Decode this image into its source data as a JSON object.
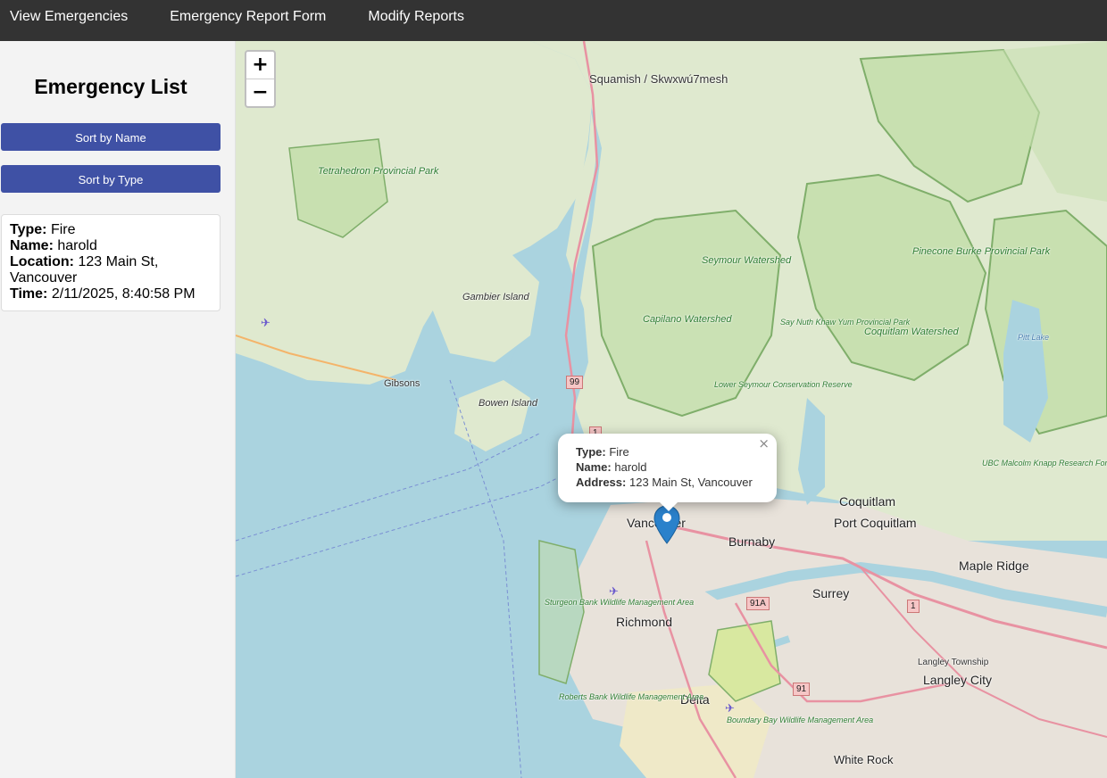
{
  "nav": {
    "items": [
      {
        "label": "View Emergencies"
      },
      {
        "label": "Emergency Report Form"
      },
      {
        "label": "Modify Reports"
      }
    ]
  },
  "sidebar": {
    "title": "Emergency List",
    "sort_name_label": "Sort by Name",
    "sort_type_label": "Sort by Type",
    "card": {
      "type_label": "Type:",
      "type": "Fire",
      "name_label": "Name:",
      "name": "harold",
      "location_label": "Location:",
      "location": "123 Main St, Vancouver",
      "time_label": "Time:",
      "time": "2/11/2025, 8:40:58 PM"
    }
  },
  "map": {
    "zoom_in": "+",
    "zoom_out": "−",
    "popup": {
      "type_label": "Type:",
      "type": "Fire",
      "name_label": "Name:",
      "name": "harold",
      "address_label": "Address:",
      "address": "123 Main St, Vancouver",
      "close": "×"
    },
    "labels": {
      "squamish": "Squamish / Skwxwú7mesh",
      "tetrahedron": "Tetrahedron Provincial Park",
      "gambier": "Gambier Island",
      "gibsons": "Gibsons",
      "bowen": "Bowen Island",
      "seymour": "Seymour Watershed",
      "capilano": "Capilano Watershed",
      "pinecone": "Pinecone Burke Provincial Park",
      "coquitlam_ws": "Coquitlam Watershed",
      "say_nuth": "Say Nuth Khaw Yum Provincial Park",
      "lower_seymour": "Lower Seymour Conservation Reserve",
      "pitt_lake": "Pitt Lake",
      "ubc_forest": "UBC Malcolm Knapp Research Forest",
      "vancouver": "Vancouver",
      "burnaby": "Burnaby",
      "coquitlam": "Coquitlam",
      "port_coquitlam": "Port Coquitlam",
      "maple_ridge": "Maple Ridge",
      "surrey": "Surrey",
      "richmond": "Richmond",
      "sturgeon": "Sturgeon Bank Wildlife Management Area",
      "delta": "Delta",
      "roberts": "Roberts Bank Wildlife Management Area",
      "boundary": "Boundary Bay Wildlife Management Area",
      "langley_tw": "Langley Township",
      "langley_city": "Langley City",
      "white_rock": "White Rock",
      "hwy99": "99",
      "hwy1a": "1",
      "hwy1b": "1",
      "hwy91a": "91A",
      "hwy91": "91"
    }
  }
}
